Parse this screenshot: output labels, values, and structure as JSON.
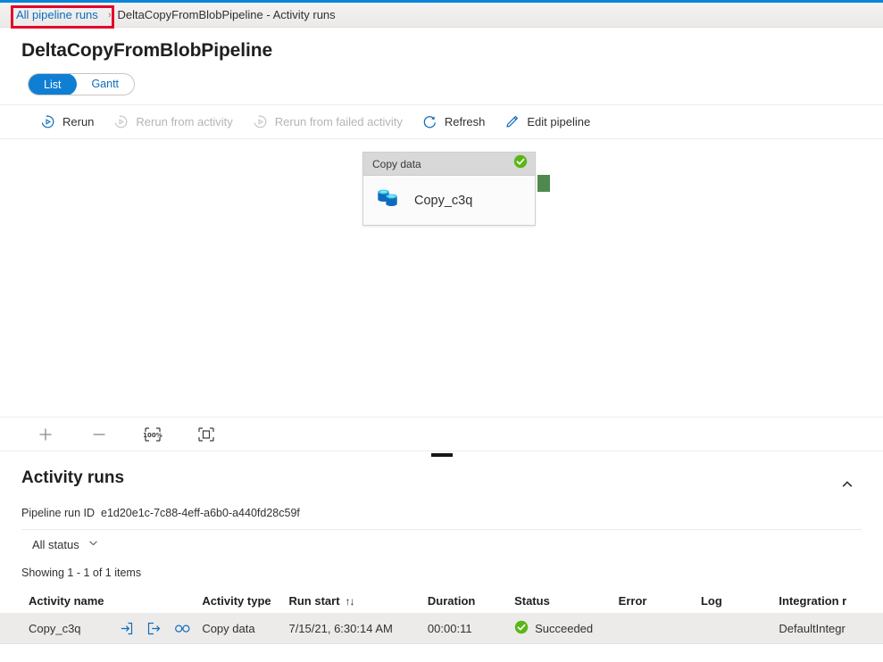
{
  "breadcrumb": {
    "link": "All pipeline runs",
    "separator": "›",
    "current": "DeltaCopyFromBlobPipeline - Activity runs"
  },
  "page": {
    "title": "DeltaCopyFromBlobPipeline"
  },
  "pivot": {
    "items": [
      {
        "label": "List",
        "selected": true
      },
      {
        "label": "Gantt",
        "selected": false
      }
    ]
  },
  "commandbar": {
    "items": [
      {
        "label": "Rerun",
        "icon": "rerun-icon",
        "disabled": false
      },
      {
        "label": "Rerun from activity",
        "icon": "rerun-from-activity-icon",
        "disabled": true
      },
      {
        "label": "Rerun from failed activity",
        "icon": "rerun-from-failed-activity-icon",
        "disabled": true
      },
      {
        "label": "Refresh",
        "icon": "refresh-icon",
        "disabled": false
      },
      {
        "label": "Edit pipeline",
        "icon": "pencil-icon",
        "disabled": false
      }
    ]
  },
  "canvas": {
    "node": {
      "header": "Copy data",
      "name": "Copy_c3q",
      "status_icon": "success-check-icon",
      "activity_icon": "copy-data-icon",
      "port_color": "#4e8a4e",
      "status_color": "#5bb615"
    },
    "tools": [
      {
        "name": "zoom-in",
        "label": "+"
      },
      {
        "name": "zoom-out",
        "label": "−"
      },
      {
        "name": "zoom-to-100",
        "label": "100%"
      },
      {
        "name": "fit-to-screen",
        "label": ""
      }
    ]
  },
  "activity_runs": {
    "title": "Activity runs",
    "collapse_icon": "chevron-up-icon",
    "run_id_label": "Pipeline run ID",
    "run_id_value": "e1d20e1c-7c88-4eff-a6b0-a440fd28c59f",
    "status_filter": "All status",
    "showing": "Showing 1 - 1 of 1 items",
    "columns": [
      "Activity name",
      "Activity type",
      "Run start",
      "Duration",
      "Status",
      "Error",
      "Log",
      "Integration r"
    ],
    "sort_column": "Run start",
    "sort_glyph": "↑↓",
    "rows": [
      {
        "activity_name": "Copy_c3q",
        "activity_type": "Copy data",
        "run_start": "7/15/21, 6:30:14 AM",
        "duration": "00:00:11",
        "status": "Succeeded",
        "error": "",
        "log": "",
        "integration_runtime": "DefaultIntegr",
        "actions": [
          "input-icon",
          "output-icon",
          "details-icon"
        ]
      }
    ]
  },
  "colors": {
    "accent": "#0f6cbd",
    "pivot_selected": "#0f7fd4",
    "annotation": "#e2062c",
    "success": "#5bb615",
    "row_bg": "#edebe9"
  }
}
